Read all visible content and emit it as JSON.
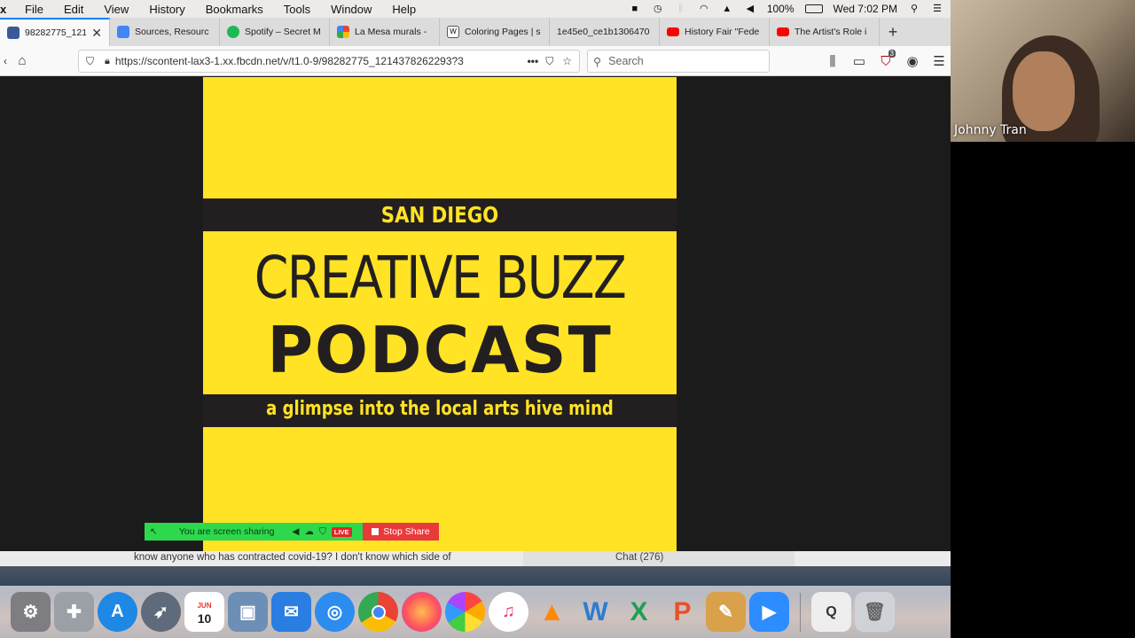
{
  "menubar": {
    "app_glyph": "x",
    "items": [
      "File",
      "Edit",
      "View",
      "History",
      "Bookmarks",
      "Tools",
      "Window",
      "Help"
    ],
    "battery": "100%",
    "clock": "Wed 7:02 PM"
  },
  "tabs": [
    {
      "label": "98282775_121",
      "favicon_color": "#3b5998",
      "favicon_icon": "facebook-icon"
    },
    {
      "label": "Sources, Resourc",
      "favicon_color": "#4285f4",
      "favicon_icon": "google-docs-icon"
    },
    {
      "label": "Spotify – Secret M",
      "favicon_color": "#1db954",
      "favicon_icon": "spotify-icon"
    },
    {
      "label": "La Mesa murals -",
      "favicon_color": "#e8a33b",
      "favicon_icon": "pinwheel-icon"
    },
    {
      "label": "Coloring Pages | s",
      "favicon_color": "#555555",
      "favicon_icon": "wix-icon"
    },
    {
      "label": "1e45e0_ce1b1306470",
      "favicon_color": "#f9f9fa",
      "favicon_icon": "blank-icon"
    },
    {
      "label": "History Fair \"Fede",
      "favicon_color": "#ff0000",
      "favicon_icon": "youtube-icon"
    },
    {
      "label": "The Artist's Role i",
      "favicon_color": "#ff0000",
      "favicon_icon": "youtube-icon"
    }
  ],
  "navbar": {
    "url": "https://scontent-lax3-1.xx.fbcdn.net/v/t1.0-9/98282775_1214378262293?3",
    "url_actions": "•••",
    "search_placeholder": "Search",
    "extension_badge": "3"
  },
  "poster": {
    "line1": "SAN DIEGO",
    "line2": "CREATIVE BUZZ",
    "line3": "PODCAST",
    "line4": "a glimpse into the local arts hive mind",
    "yellow": "#ffe324",
    "dark": "#231f20"
  },
  "sharebar": {
    "status": "You are screen sharing",
    "live": "LIVE",
    "stop": "Stop Share"
  },
  "chat": {
    "message": "know anyone who has contracted covid-19? I don't know which side of",
    "label": "Chat (276)"
  },
  "dock": {
    "calendar_month": "JUN",
    "calendar_day": "10"
  },
  "video": {
    "participant": "Johnny Tran"
  }
}
